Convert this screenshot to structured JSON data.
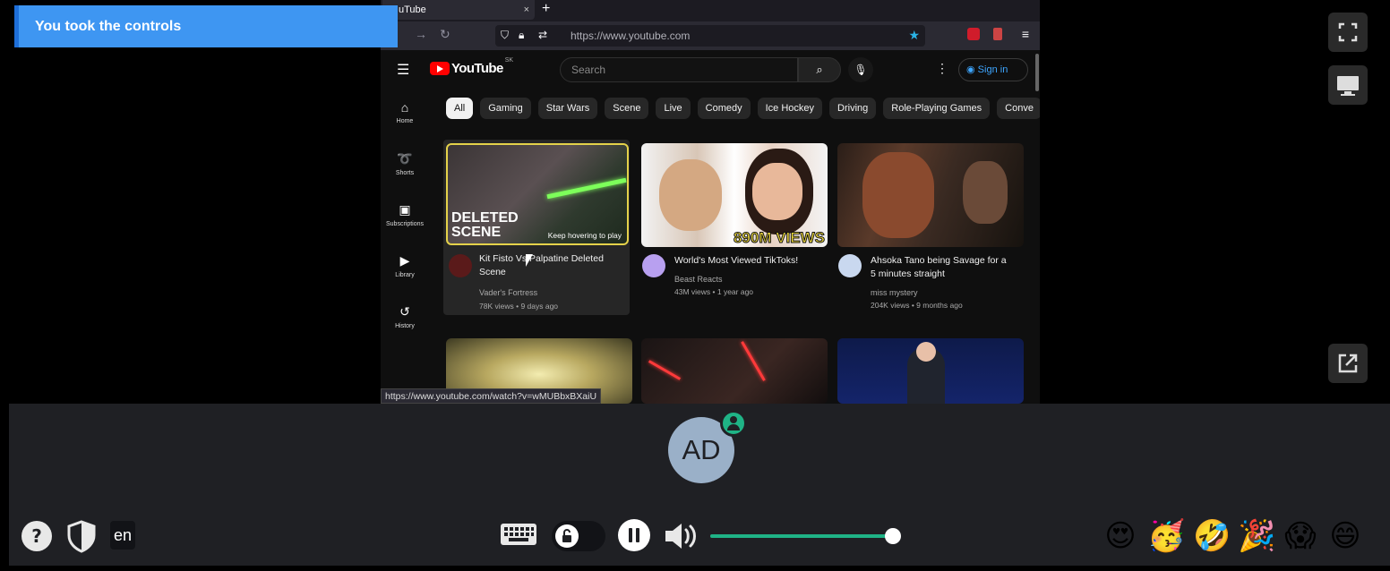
{
  "toast": {
    "text": "You took the controls"
  },
  "browser": {
    "tab_title": "YouTube",
    "tab_title_partial": "uTube",
    "new_tab": "+",
    "tab_close": "×",
    "url": "https://www.youtube.com",
    "status_url": "https://www.youtube.com/watch?v=wMUBbxBXaiU"
  },
  "youtube": {
    "logo": "YouTube",
    "country_code": "SK",
    "search_placeholder": "Search",
    "sign_in": "Sign in",
    "chips": [
      "All",
      "Gaming",
      "Star Wars",
      "Scene",
      "Live",
      "Comedy",
      "Ice Hockey",
      "Driving",
      "Role-Playing Games",
      "Conve"
    ],
    "sidebar": [
      {
        "label": "Home",
        "icon": "home-icon"
      },
      {
        "label": "Shorts",
        "icon": "shorts-icon"
      },
      {
        "label": "Subscriptions",
        "icon": "subscriptions-icon"
      },
      {
        "label": "Library",
        "icon": "library-icon"
      },
      {
        "label": "History",
        "icon": "history-icon"
      }
    ],
    "videos": [
      {
        "title": "Kit Fisto Vs Palpatine Deleted Scene",
        "channel": "Vader's Fortress",
        "meta": "78K views • 9 days ago",
        "overlay_1": "DELETED",
        "overlay_2": "SCENE",
        "hover_hint": "Keep hovering to play"
      },
      {
        "title": "World's Most Viewed TikToks!",
        "channel": "Beast Reacts",
        "meta": "43M views • 1 year ago",
        "overlay_1": "890M VIEWS"
      },
      {
        "title": "Ahsoka Tano being Savage for a 5 minutes straight",
        "channel": "miss mystery",
        "meta": "204K views • 9 months ago"
      }
    ]
  },
  "session": {
    "avatar_initials": "AD",
    "language": "en",
    "volume_fraction": 0.96,
    "reactions": [
      "😍",
      "🥳",
      "🤣",
      "🎉",
      "😱",
      "😄"
    ]
  },
  "colors": {
    "accent": "#1fb386",
    "toast_bg": "#3e96f2",
    "youtube_red": "#ff0000"
  }
}
